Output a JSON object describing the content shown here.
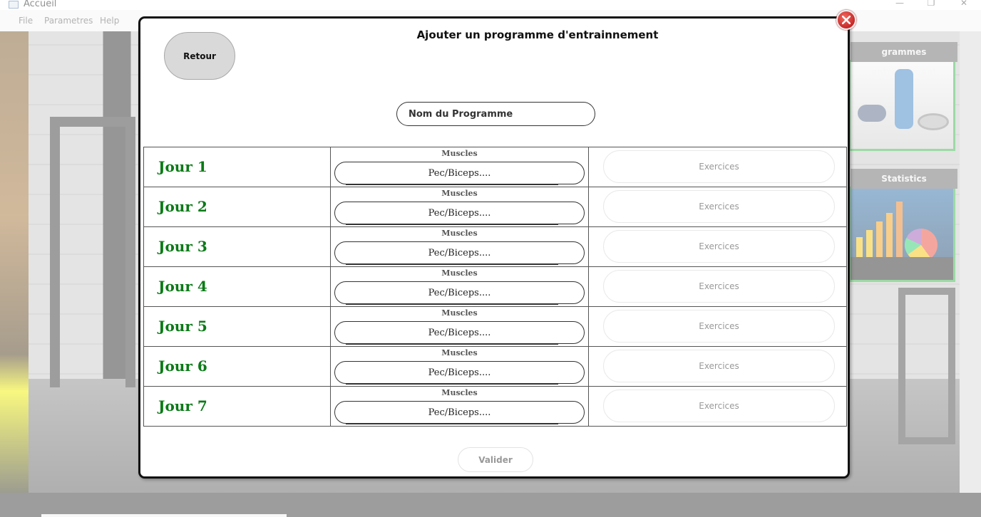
{
  "window": {
    "title": "Accueil",
    "menu": [
      "File",
      "Parametres",
      "Help"
    ],
    "controls": [
      "minimize-icon",
      "restore-icon",
      "close-icon"
    ]
  },
  "background": {
    "card_programmes_caption": "grammes entrainement",
    "card_statistics_caption": "Statistics"
  },
  "dialog": {
    "title": "Ajouter un programme d'entrainnement",
    "back_label": "Retour",
    "program_name_placeholder": "Nom du Programme",
    "muscles_label": "Muscles",
    "muscles_placeholder": "Pec/Biceps....",
    "exercises_label": "Exercices",
    "validate_label": "Valider",
    "days": [
      {
        "label": "Jour 1"
      },
      {
        "label": "Jour 2"
      },
      {
        "label": "Jour 3"
      },
      {
        "label": "Jour 4"
      },
      {
        "label": "Jour 5"
      },
      {
        "label": "Jour 6"
      },
      {
        "label": "Jour 7"
      }
    ]
  },
  "colors": {
    "day_label": "#0b7a17",
    "close_button": "#d32f2f",
    "card_border": "#39b54a"
  }
}
